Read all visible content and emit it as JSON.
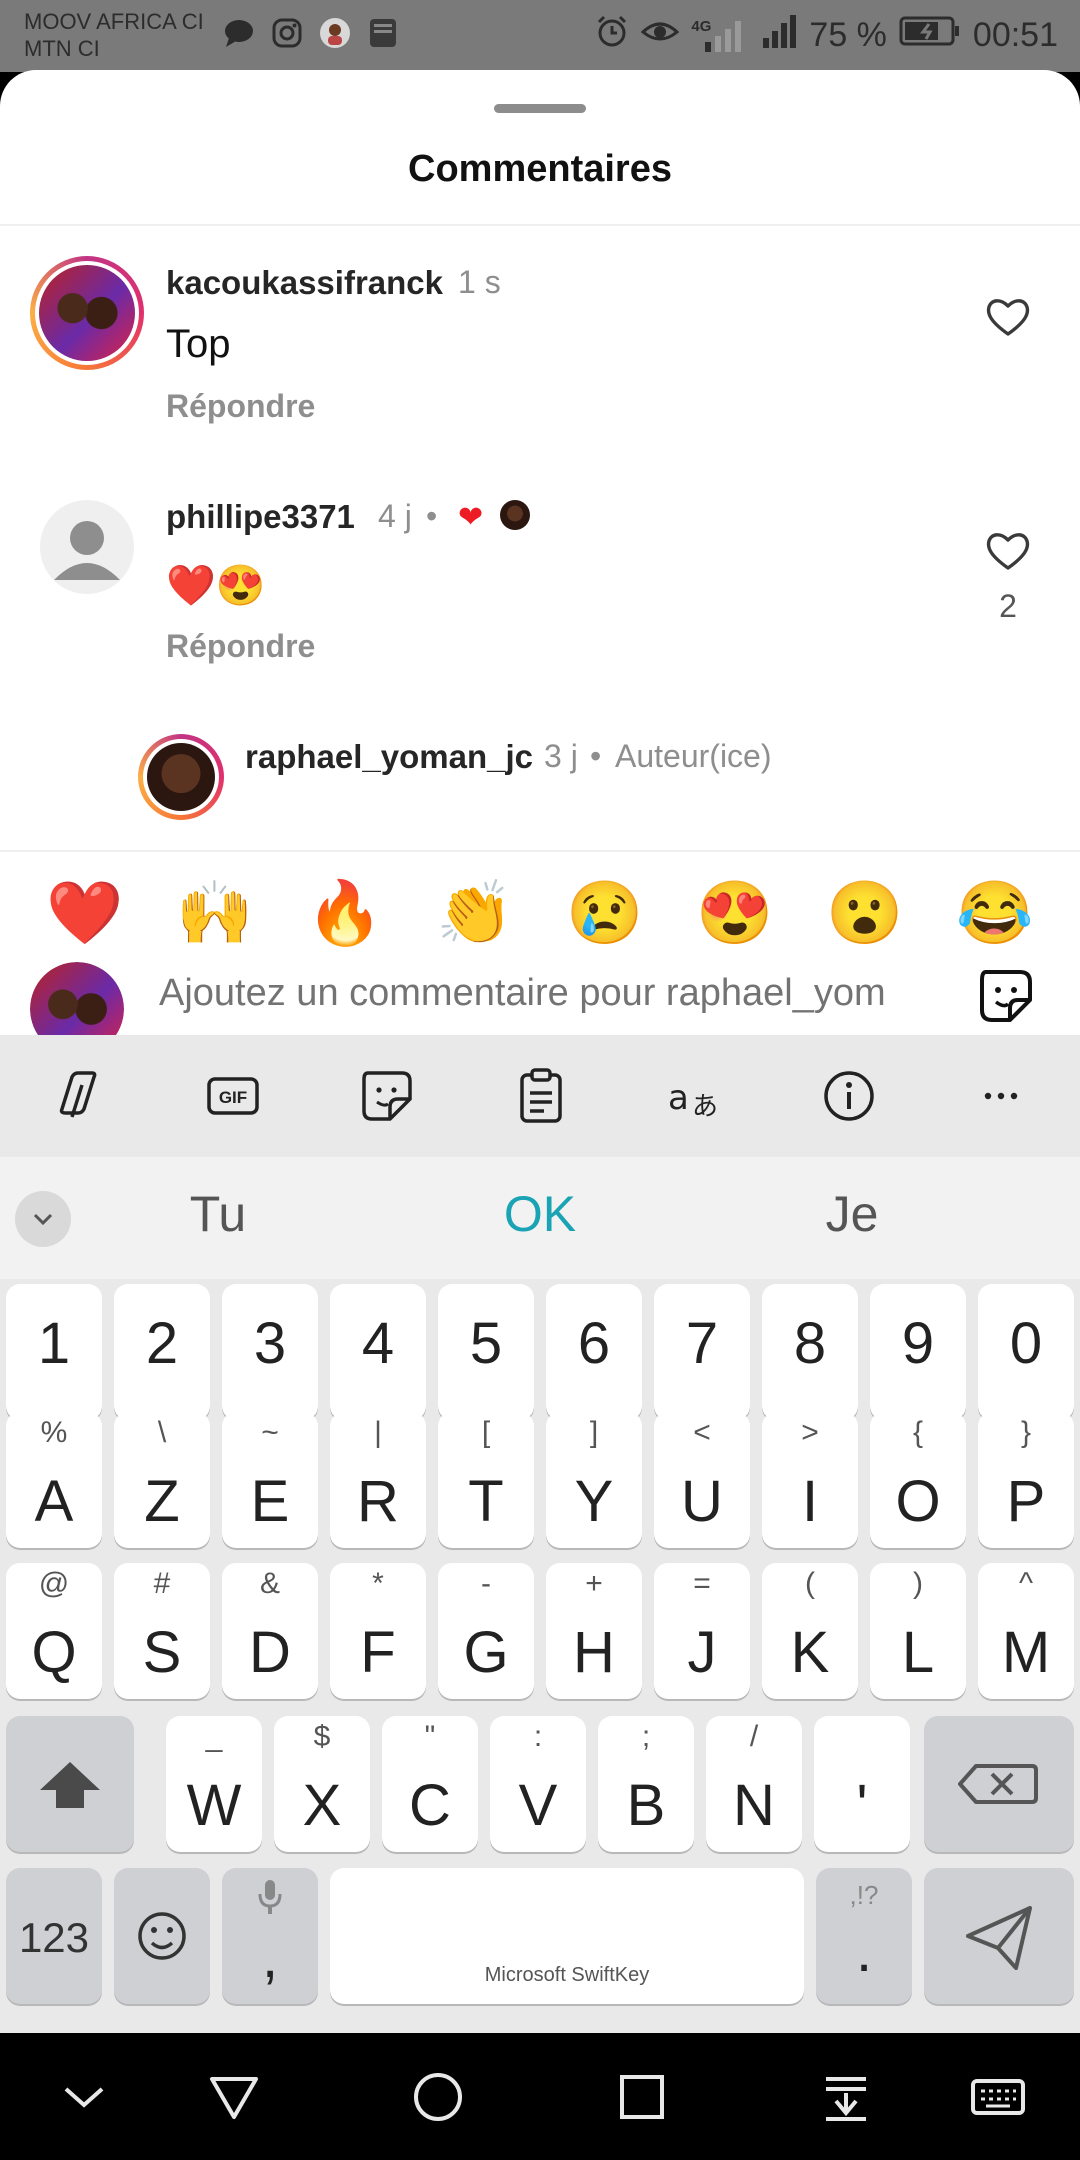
{
  "status": {
    "carrier1": "MOOV AFRICA CI",
    "carrier2": "MTN CI",
    "network": "4G",
    "battery": "75 %",
    "time": "00:51"
  },
  "sheet": {
    "title": "Commentaires"
  },
  "comments": [
    {
      "username": "kacoukassifranck",
      "time": "1 s",
      "text": "Top",
      "reply": "Répondre"
    },
    {
      "username": "phillipe3371",
      "time": "4 j",
      "text": "❤️😍",
      "reply": "Répondre",
      "likes": "2"
    },
    {
      "username": "raphael_yoman_jc",
      "time": "3 j",
      "badge": "Auteur(ice)"
    }
  ],
  "reactions": [
    "❤️",
    "🙌",
    "🔥",
    "👏",
    "😢",
    "😍",
    "😮",
    "😂"
  ],
  "input": {
    "placeholder": "Ajoutez un commentaire pour raphael_yom"
  },
  "keyboard": {
    "suggestions": [
      "Tu",
      "OK",
      "Je"
    ],
    "numbers": [
      "1",
      "2",
      "3",
      "4",
      "5",
      "6",
      "7",
      "8",
      "9",
      "0"
    ],
    "row1": [
      {
        "k": "A",
        "s": "%"
      },
      {
        "k": "Z",
        "s": "\\"
      },
      {
        "k": "E",
        "s": "~"
      },
      {
        "k": "R",
        "s": "|"
      },
      {
        "k": "T",
        "s": "["
      },
      {
        "k": "Y",
        "s": "]"
      },
      {
        "k": "U",
        "s": "<"
      },
      {
        "k": "I",
        "s": ">"
      },
      {
        "k": "O",
        "s": "{"
      },
      {
        "k": "P",
        "s": "}"
      }
    ],
    "row2": [
      {
        "k": "Q",
        "s": "@"
      },
      {
        "k": "S",
        "s": "#"
      },
      {
        "k": "D",
        "s": "&"
      },
      {
        "k": "F",
        "s": "*"
      },
      {
        "k": "G",
        "s": "-"
      },
      {
        "k": "H",
        "s": "+"
      },
      {
        "k": "J",
        "s": "="
      },
      {
        "k": "K",
        "s": "("
      },
      {
        "k": "L",
        "s": ")"
      },
      {
        "k": "M",
        "s": "^"
      }
    ],
    "row3": [
      {
        "k": "W",
        "s": "_"
      },
      {
        "k": "X",
        "s": "$"
      },
      {
        "k": "C",
        "s": "\""
      },
      {
        "k": "V",
        "s": ":"
      },
      {
        "k": "B",
        "s": ";"
      },
      {
        "k": "N",
        "s": "/"
      },
      {
        "k": "'",
        "s": ""
      }
    ],
    "numbers_key": "123",
    "space_label": "Microsoft SwiftKey",
    "comma": ",",
    "period": ".",
    "period_sec": ",!?"
  }
}
